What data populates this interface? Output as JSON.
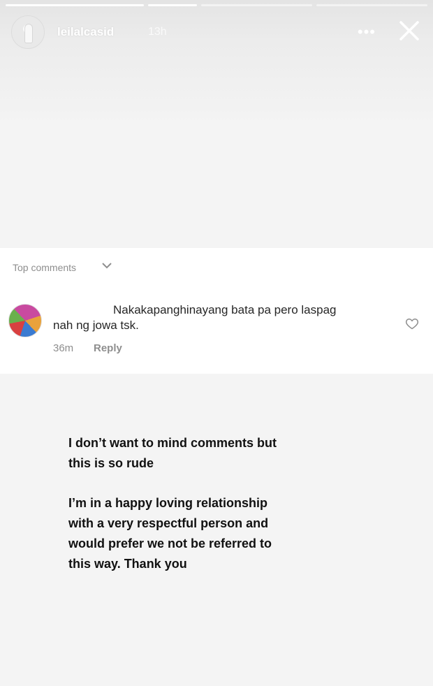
{
  "story": {
    "progress": [
      1,
      1,
      0,
      0
    ],
    "username": "leilalcasid",
    "time": "13h",
    "more_label": "•••"
  },
  "comments": {
    "section_label": "Top comments",
    "items": [
      {
        "text_line1": "Nakakapanghinayang bata pa pero laspag",
        "text_line2": "nah ng jowa tsk.",
        "time": "36m",
        "reply_label": "Reply"
      }
    ]
  },
  "message": {
    "paragraph1": "I don’t want to mind comments but this is so rude",
    "paragraph2": "I’m in a happy loving relationship with a very respectful person and would prefer we not be referred to this way. Thank you"
  },
  "colors": {
    "secondary_text": "#8e8e8e",
    "primary_text": "#262626",
    "card_bg": "#ffffff"
  },
  "icons": [
    "close-icon",
    "more-icon",
    "chevron-down-icon",
    "heart-outline-icon"
  ]
}
